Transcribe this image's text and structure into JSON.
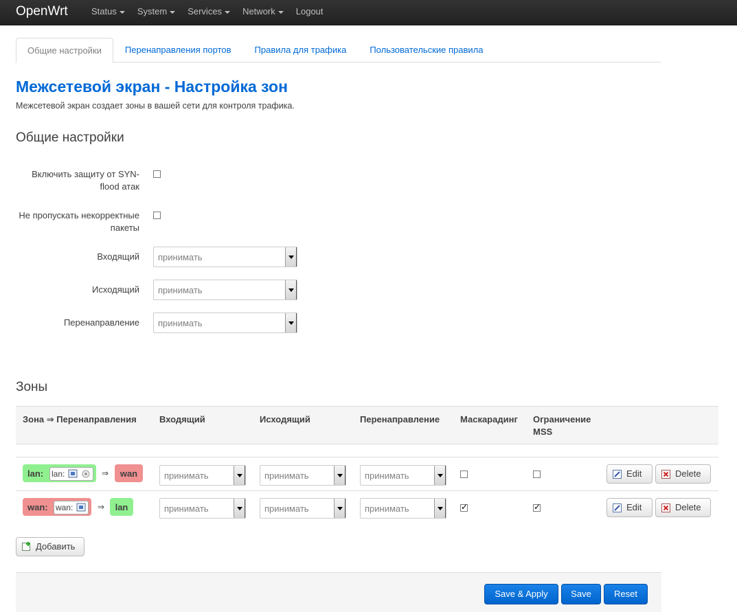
{
  "navbar": {
    "brand": "OpenWrt",
    "items": [
      {
        "label": "Status",
        "has_caret": true
      },
      {
        "label": "System",
        "has_caret": true
      },
      {
        "label": "Services",
        "has_caret": true
      },
      {
        "label": "Network",
        "has_caret": true
      },
      {
        "label": "Logout",
        "has_caret": false
      }
    ]
  },
  "tabs": [
    {
      "label": "Общие настройки",
      "active": true
    },
    {
      "label": "Перенаправления портов",
      "active": false
    },
    {
      "label": "Правила для трафика",
      "active": false
    },
    {
      "label": "Пользовательские правила",
      "active": false
    }
  ],
  "page": {
    "title": "Межсетевой экран - Настройка зон",
    "description": "Межсетевой экран создает зоны в вашей сети для контроля трафика."
  },
  "general": {
    "heading": "Общие настройки",
    "syn_flood_label_1": "Включить защиту от SYN-",
    "syn_flood_label_2": "flood атак",
    "syn_flood_checked": false,
    "drop_invalid_label_1": "Не пропускать некорректные",
    "drop_invalid_label_2": "пакеты",
    "drop_invalid_checked": false,
    "input_label": "Входящий",
    "input_value": "принимать",
    "output_label": "Исходящий",
    "output_value": "принимать",
    "forward_label": "Перенаправление",
    "forward_value": "принимать"
  },
  "zones": {
    "heading": "Зоны",
    "columns": {
      "zone": "Зона ⇒ Перенаправления",
      "input": "Входящий",
      "output": "Исходящий",
      "forward": "Перенаправление",
      "masq": "Маскарадинг",
      "mss_1": "Ограничение",
      "mss_2": "MSS"
    },
    "arrow": "⇒",
    "rows": [
      {
        "zone": "lan:",
        "networks": "lan:",
        "forward_to": "wan",
        "input": "принимать",
        "output": "принимать",
        "forward": "принимать",
        "masq": false,
        "mss": false
      },
      {
        "zone": "wan:",
        "networks": "wan:",
        "forward_to": "lan",
        "input": "принимать",
        "output": "принимать",
        "forward": "принимать",
        "masq": true,
        "mss": true
      }
    ],
    "edit_label": "Edit",
    "delete_label": "Delete",
    "add_label": "Добавить"
  },
  "footer": {
    "save_apply": "Save & Apply",
    "save": "Save",
    "reset": "Reset"
  },
  "colors": {
    "accent": "#0069d6",
    "zone_lan": "#90f090",
    "zone_wan": "#f09090",
    "primary_button": "#0064cd"
  }
}
